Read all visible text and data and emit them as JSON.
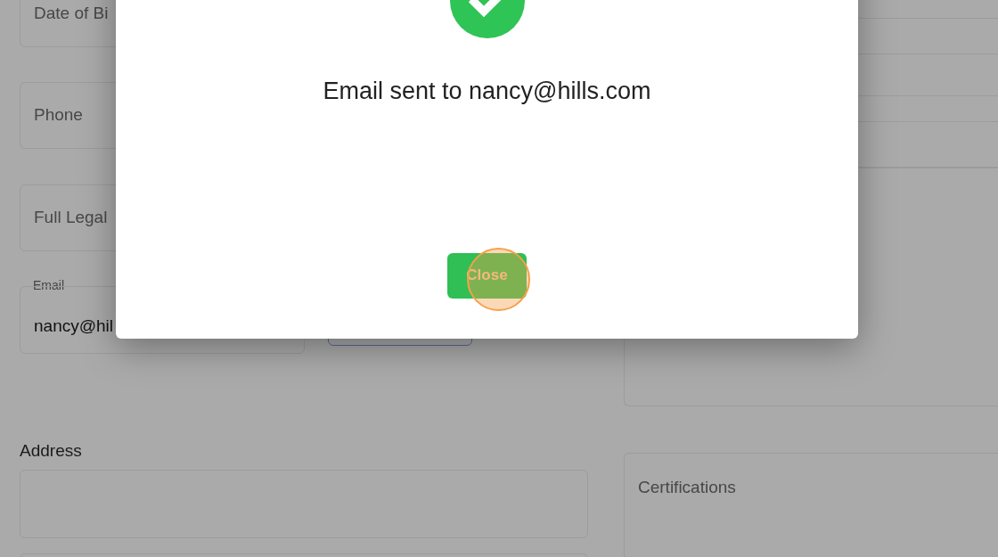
{
  "form": {
    "left_fields": [
      {
        "kind": "field",
        "label": "Date of Bi"
      },
      {
        "kind": "field",
        "label": "Phone"
      },
      {
        "kind": "field",
        "label": "Full Legal"
      },
      {
        "kind": "outlined",
        "label": "Email",
        "value": "nancy@hil"
      }
    ],
    "address": {
      "label": "Address"
    },
    "right_panels": [
      {
        "label": "Certifications"
      }
    ]
  },
  "dialog": {
    "message": "Email sent to nancy@hills.com",
    "button": "Close"
  }
}
